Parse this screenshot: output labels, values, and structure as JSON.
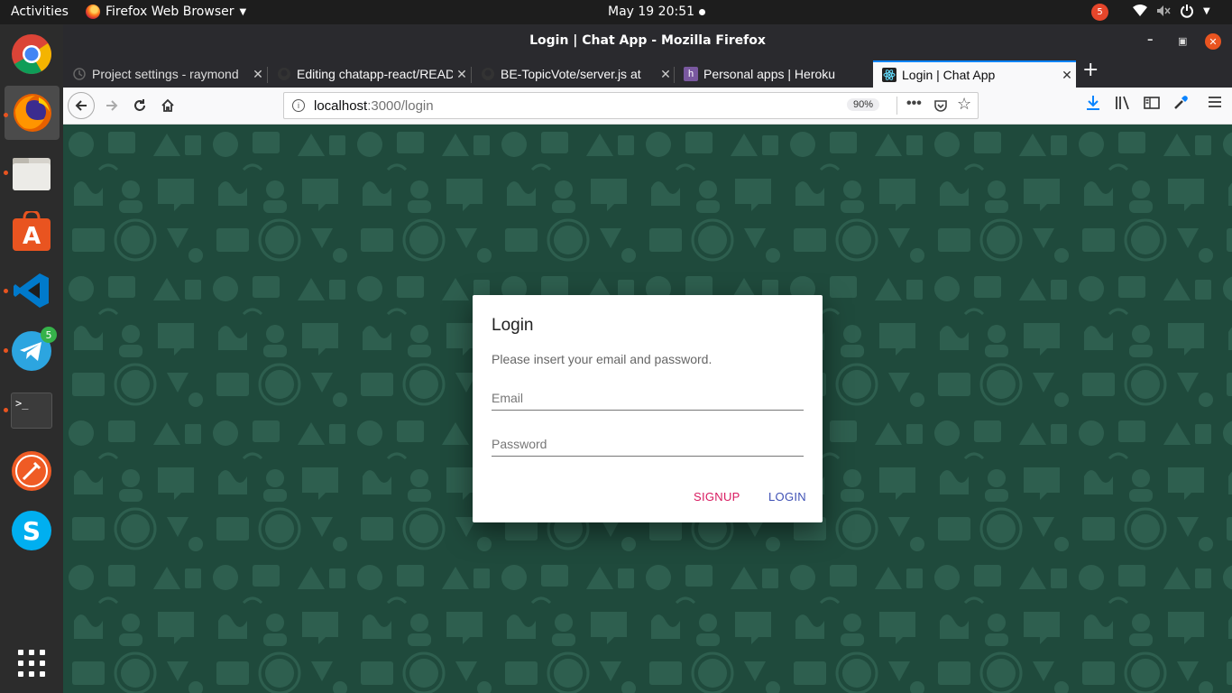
{
  "topbar": {
    "activities": "Activities",
    "app_menu": "Firefox Web Browser",
    "clock": "May 19  20:51",
    "notification_count": "5"
  },
  "dock": {
    "items": [
      {
        "name": "Chrome",
        "icon": "chrome-icon"
      },
      {
        "name": "Firefox",
        "icon": "firefox-icon"
      },
      {
        "name": "Files",
        "icon": "files-icon"
      },
      {
        "name": "Software",
        "icon": "software-icon"
      },
      {
        "name": "VS Code",
        "icon": "vscode-icon"
      },
      {
        "name": "Telegram",
        "icon": "telegram-icon",
        "badge": "5"
      },
      {
        "name": "Terminal",
        "icon": "terminal-icon",
        "glyph": ">_"
      },
      {
        "name": "Postman",
        "icon": "postman-icon"
      },
      {
        "name": "Skype",
        "icon": "skype-icon"
      },
      {
        "name": "Show Applications",
        "icon": "app-grid-icon"
      }
    ]
  },
  "window": {
    "title": "Login | Chat App - Mozilla Firefox"
  },
  "tabs": [
    {
      "label": "Project settings - raymond",
      "active": false
    },
    {
      "label": "Editing chatapp-react/README",
      "active": false
    },
    {
      "label": "BE-TopicVote/server.js at",
      "active": false
    },
    {
      "label": "Personal apps | Heroku",
      "active": false
    },
    {
      "label": "Login | Chat App",
      "active": true
    }
  ],
  "urlbar": {
    "host": "localhost",
    "path": ":3000/login",
    "zoom": "90%"
  },
  "dialog": {
    "title": "Login",
    "text": "Please insert your email and password.",
    "email_placeholder": "Email",
    "password_placeholder": "Password",
    "signup_label": "SIGNUP",
    "login_label": "LOGIN"
  },
  "colors": {
    "page_background": "#1f4a3c",
    "signup": "#d81b60",
    "login": "#3f51b5",
    "ubuntu_accent": "#e95420"
  }
}
